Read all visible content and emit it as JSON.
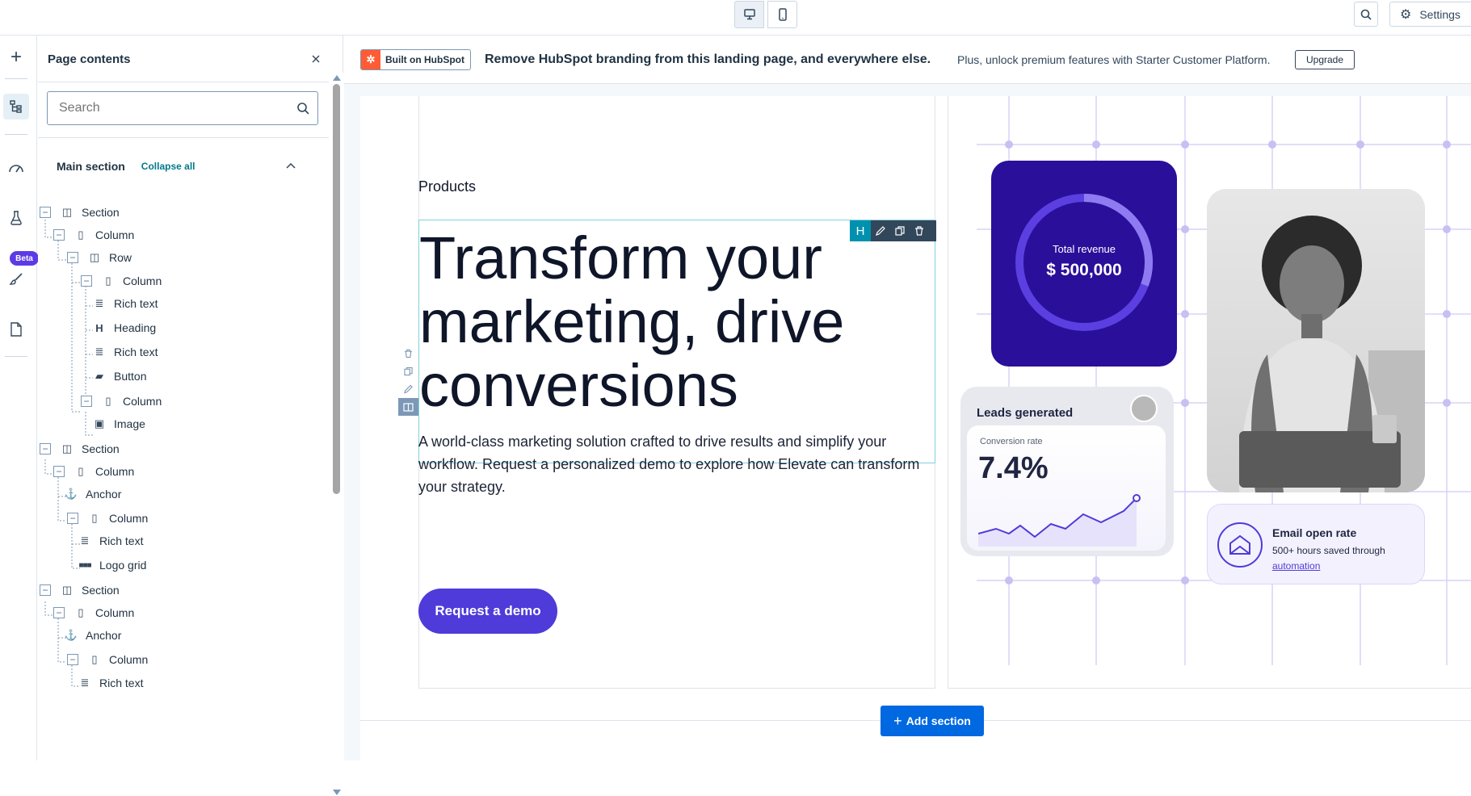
{
  "topbar": {
    "settings_label": "Settings",
    "icons": {
      "desktop": "desktop-icon",
      "mobile": "mobile-icon",
      "search": "search-icon",
      "settings": "gear-icon"
    }
  },
  "rail": {
    "beta_label": "Beta",
    "icons": [
      "plus-icon",
      "tree-icon",
      "gauge-icon",
      "flask-icon",
      "brush-icon",
      "document-icon"
    ]
  },
  "panel": {
    "title": "Page contents",
    "search_placeholder": "Search",
    "section_header": "Main section",
    "collapse_all": "Collapse all",
    "tree": [
      {
        "label": "Section",
        "icon": "section-icon"
      },
      {
        "label": "Column",
        "icon": "column-icon"
      },
      {
        "label": "Row",
        "icon": "row-icon"
      },
      {
        "label": "Column",
        "icon": "column-icon"
      },
      {
        "label": "Rich text",
        "icon": "rich-text-icon"
      },
      {
        "label": "Heading",
        "icon": "heading-icon"
      },
      {
        "label": "Rich text",
        "icon": "rich-text-icon"
      },
      {
        "label": "Button",
        "icon": "button-icon"
      },
      {
        "label": "Column",
        "icon": "column-icon"
      },
      {
        "label": "Image",
        "icon": "image-icon"
      },
      {
        "label": "Section",
        "icon": "section-icon"
      },
      {
        "label": "Column",
        "icon": "column-icon"
      },
      {
        "label": "Anchor",
        "icon": "anchor-icon"
      },
      {
        "label": "Column",
        "icon": "column-icon"
      },
      {
        "label": "Rich text",
        "icon": "rich-text-icon"
      },
      {
        "label": "Logo grid",
        "icon": "logo-grid-icon"
      },
      {
        "label": "Section",
        "icon": "section-icon"
      },
      {
        "label": "Column",
        "icon": "column-icon"
      },
      {
        "label": "Anchor",
        "icon": "anchor-icon"
      },
      {
        "label": "Column",
        "icon": "column-icon"
      },
      {
        "label": "Rich text",
        "icon": "rich-text-icon"
      }
    ]
  },
  "banner": {
    "badge": "Built on HubSpot",
    "headline": "Remove HubSpot branding from this landing page, and everywhere else.",
    "subtext": "Plus, unlock premium features with Starter Customer Platform.",
    "upgrade": "Upgrade"
  },
  "hero": {
    "eyebrow": "Products",
    "heading_lines": [
      "Transform your",
      "marketing, drive",
      "conversions"
    ],
    "module_tag": "H",
    "body": "A world-class marketing solution crafted to drive results and simplify your workflow. Request a personalized demo to explore how Elevate can transform your strategy.",
    "cta": "Request a demo"
  },
  "cards": {
    "revenue_label": "Total revenue",
    "revenue_value": "$ 500,000",
    "leads_title": "Leads generated",
    "conversion_label": "Conversion rate",
    "conversion_value": "7.4%",
    "email_title": "Email open rate",
    "email_text": "500+ hours saved through",
    "email_link": "automation"
  },
  "add_section": "Add section",
  "colors": {
    "accent": "#4f3bd9",
    "brand": "#ff5c35",
    "primary_button": "#0068e0",
    "teal": "#0091ae"
  }
}
